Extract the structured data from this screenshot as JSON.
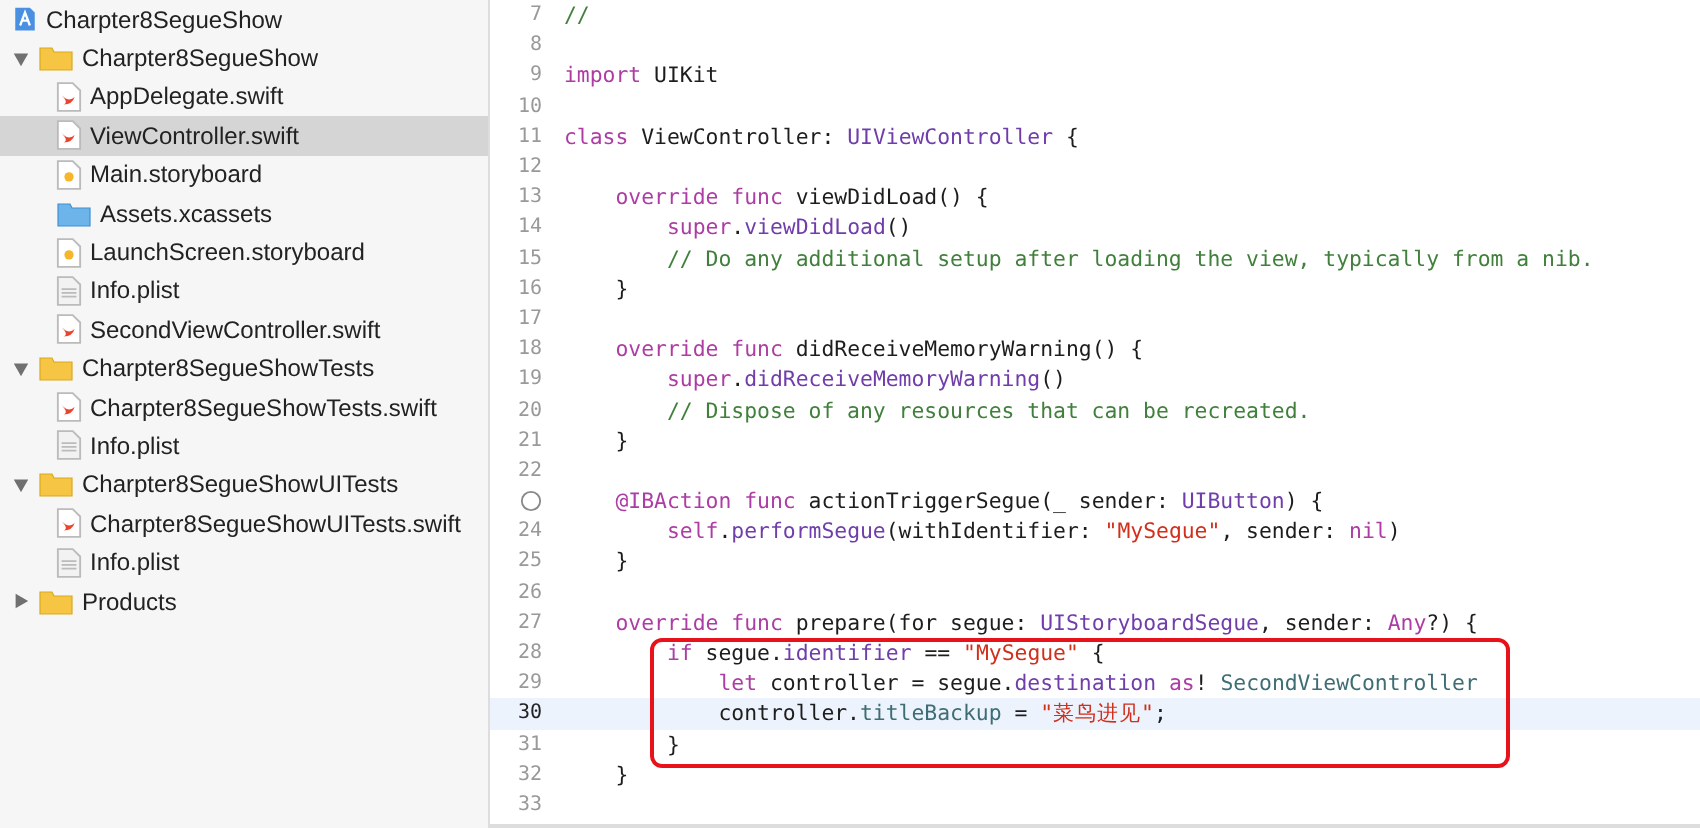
{
  "navigator": {
    "items": [
      {
        "kind": "project",
        "label": "Charpter8SegueShow",
        "selected": false
      },
      {
        "kind": "folder",
        "label": "Charpter8SegueShow",
        "expanded": true,
        "selected": false,
        "children": [
          {
            "kind": "swift",
            "label": "AppDelegate.swift",
            "selected": false
          },
          {
            "kind": "swift",
            "label": "ViewController.swift",
            "selected": true
          },
          {
            "kind": "storyboard",
            "label": "Main.storyboard",
            "selected": false
          },
          {
            "kind": "assets",
            "label": "Assets.xcassets",
            "selected": false
          },
          {
            "kind": "storyboard",
            "label": "LaunchScreen.storyboard",
            "selected": false
          },
          {
            "kind": "plist",
            "label": "Info.plist",
            "selected": false
          },
          {
            "kind": "swift",
            "label": "SecondViewController.swift",
            "selected": false
          }
        ]
      },
      {
        "kind": "folder",
        "label": "Charpter8SegueShowTests",
        "expanded": true,
        "selected": false,
        "children": [
          {
            "kind": "swift",
            "label": "Charpter8SegueShowTests.swift",
            "selected": false
          },
          {
            "kind": "plist",
            "label": "Info.plist",
            "selected": false
          }
        ]
      },
      {
        "kind": "folder",
        "label": "Charpter8SegueShowUITests",
        "expanded": true,
        "selected": false,
        "children": [
          {
            "kind": "swift",
            "label": "Charpter8SegueShowUITests.swift",
            "selected": false
          },
          {
            "kind": "plist",
            "label": "Info.plist",
            "selected": false
          }
        ]
      },
      {
        "kind": "folder",
        "label": "Products",
        "expanded": false,
        "selected": false
      }
    ]
  },
  "editor": {
    "lines": [
      {
        "number": "7",
        "tokens": [
          {
            "kind": "comment",
            "text": "//"
          }
        ]
      },
      {
        "number": "8"
      },
      {
        "number": "9",
        "tokens": [
          {
            "kind": "keyword",
            "text": "import"
          },
          {
            "kind": "plain",
            "text": " UIKit"
          }
        ]
      },
      {
        "number": "10"
      },
      {
        "number": "11",
        "tokens": [
          {
            "kind": "keyword",
            "text": "class"
          },
          {
            "kind": "plain",
            "text": " ViewController: "
          },
          {
            "kind": "type",
            "text": "UIViewController"
          },
          {
            "kind": "plain",
            "text": " {"
          }
        ]
      },
      {
        "number": "12"
      },
      {
        "number": "13",
        "tokens": [
          {
            "kind": "keyword",
            "text": "    override func"
          },
          {
            "kind": "plain",
            "text": " viewDidLoad() {"
          }
        ]
      },
      {
        "number": "14",
        "tokens": [
          {
            "kind": "keyword",
            "text": "        super"
          },
          {
            "kind": "plain",
            "text": "."
          },
          {
            "kind": "member",
            "text": "viewDidLoad"
          },
          {
            "kind": "plain",
            "text": "()"
          }
        ]
      },
      {
        "number": "15",
        "tokens": [
          {
            "kind": "comment",
            "text": "        // Do any additional setup after loading the view, typically from a nib."
          }
        ]
      },
      {
        "number": "16",
        "tokens": [
          {
            "kind": "plain",
            "text": "    }"
          }
        ]
      },
      {
        "number": "17"
      },
      {
        "number": "18",
        "tokens": [
          {
            "kind": "keyword",
            "text": "    override func"
          },
          {
            "kind": "plain",
            "text": " didReceiveMemoryWarning() {"
          }
        ]
      },
      {
        "number": "19",
        "tokens": [
          {
            "kind": "keyword",
            "text": "        super"
          },
          {
            "kind": "plain",
            "text": "."
          },
          {
            "kind": "member",
            "text": "didReceiveMemoryWarning"
          },
          {
            "kind": "plain",
            "text": "()"
          }
        ]
      },
      {
        "number": "20",
        "tokens": [
          {
            "kind": "comment",
            "text": "        // Dispose of any resources that can be recreated."
          }
        ]
      },
      {
        "number": "21",
        "tokens": [
          {
            "kind": "plain",
            "text": "    }"
          }
        ]
      },
      {
        "number": "22"
      },
      {
        "outlet_connected": false,
        "tokens": [
          {
            "kind": "keyword",
            "text": "    @IBAction func"
          },
          {
            "kind": "plain",
            "text": " actionTriggerSegue(_ sender: "
          },
          {
            "kind": "type",
            "text": "UIButton"
          },
          {
            "kind": "plain",
            "text": ") {"
          }
        ]
      },
      {
        "number": "24",
        "tokens": [
          {
            "kind": "keyword",
            "text": "        self"
          },
          {
            "kind": "plain",
            "text": "."
          },
          {
            "kind": "member",
            "text": "performSegue"
          },
          {
            "kind": "plain",
            "text": "(withIdentifier: "
          },
          {
            "kind": "string",
            "text": "\"MySegue\""
          },
          {
            "kind": "plain",
            "text": ", sender: "
          },
          {
            "kind": "keyword",
            "text": "nil"
          },
          {
            "kind": "plain",
            "text": ")"
          }
        ]
      },
      {
        "number": "25",
        "tokens": [
          {
            "kind": "plain",
            "text": "    }"
          }
        ]
      },
      {
        "number": "26"
      },
      {
        "number": "27",
        "tokens": [
          {
            "kind": "keyword",
            "text": "    override func"
          },
          {
            "kind": "plain",
            "text": " prepare(for segue: "
          },
          {
            "kind": "type",
            "text": "UIStoryboardSegue"
          },
          {
            "kind": "plain",
            "text": ", sender: "
          },
          {
            "kind": "keyword",
            "text": "Any"
          },
          {
            "kind": "plain",
            "text": "?) {"
          }
        ]
      },
      {
        "number": "28",
        "boxed": true,
        "tokens": [
          {
            "kind": "keyword",
            "text": "        if"
          },
          {
            "kind": "plain",
            "text": " segue."
          },
          {
            "kind": "member",
            "text": "identifier"
          },
          {
            "kind": "plain",
            "text": " == "
          },
          {
            "kind": "string",
            "text": "\"MySegue\""
          },
          {
            "kind": "plain",
            "text": " {"
          }
        ]
      },
      {
        "number": "29",
        "boxed": true,
        "tokens": [
          {
            "kind": "keyword",
            "text": "            let"
          },
          {
            "kind": "plain",
            "text": " controller = segue."
          },
          {
            "kind": "member",
            "text": "destination"
          },
          {
            "kind": "keyword",
            "text": " as"
          },
          {
            "kind": "plain",
            "text": "! "
          },
          {
            "kind": "project",
            "text": "SecondViewController"
          }
        ]
      },
      {
        "number": "30",
        "boxed": true,
        "selected": true,
        "tokens": [
          {
            "kind": "plain",
            "text": "            controller."
          },
          {
            "kind": "project",
            "text": "titleBackup"
          },
          {
            "kind": "plain",
            "text": " = "
          },
          {
            "kind": "string",
            "text": "\"菜鸟进见\""
          },
          {
            "kind": "plain",
            "text": ";"
          }
        ]
      },
      {
        "number": "31",
        "boxed": true,
        "tokens": [
          {
            "kind": "plain",
            "text": "        }"
          }
        ]
      },
      {
        "number": "32",
        "tokens": [
          {
            "kind": "plain",
            "text": "    }"
          }
        ]
      },
      {
        "number": "33"
      }
    ]
  }
}
